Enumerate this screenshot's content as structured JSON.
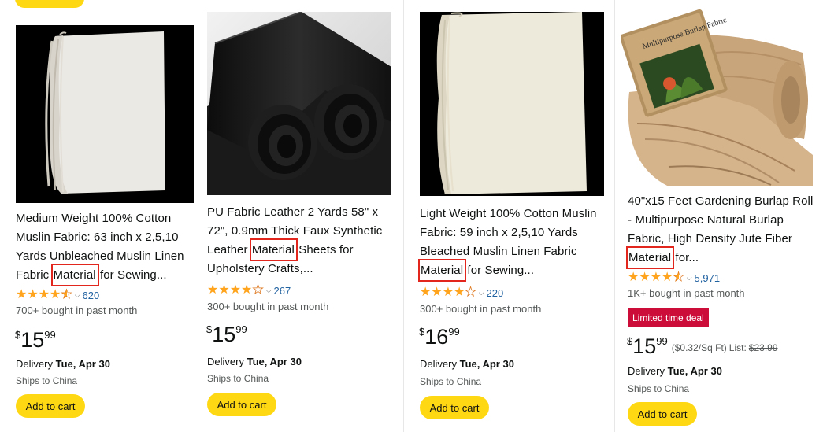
{
  "products": [
    {
      "title_pre": "Medium Weight 100% Cotton Muslin Fabric: 63 inch x 2,5,10 Yards Unbleached Muslin Linen Fabric ",
      "highlight": "Material",
      "title_post": " for Sewing...",
      "rating_count": "620",
      "bought": "700+ bought in past month",
      "price_symbol": "$",
      "price_whole": "15",
      "price_fraction": "99",
      "delivery_label": "Delivery",
      "delivery_date": "Tue, Apr 30",
      "ships": "Ships to China",
      "cart_label": "Add to cart"
    },
    {
      "title_pre": "PU Fabric Leather 2 Yards 58\" x 72\", 0.9mm Thick Faux Synthetic Leather ",
      "highlight": "Material",
      "title_post": " Sheets for Upholstery Crafts,...",
      "rating_count": "267",
      "bought": "300+ bought in past month",
      "price_symbol": "$",
      "price_whole": "15",
      "price_fraction": "99",
      "delivery_label": "Delivery",
      "delivery_date": "Tue, Apr 30",
      "ships": "Ships to China",
      "cart_label": "Add to cart"
    },
    {
      "title_pre": "Light Weight 100% Cotton Muslin Fabric: 59 inch x 2,5,10 Yards Bleached Muslin Linen Fabric ",
      "highlight": "Material",
      "title_post": " for Sewing...",
      "rating_count": "220",
      "bought": "300+ bought in past month",
      "price_symbol": "$",
      "price_whole": "16",
      "price_fraction": "99",
      "delivery_label": "Delivery",
      "delivery_date": "Tue, Apr 30",
      "ships": "Ships to China",
      "cart_label": "Add to cart"
    },
    {
      "title_pre": "40\"x15 Feet Gardening Burlap Roll - Multipurpose Natural Burlap Fabric, High Density Jute Fiber ",
      "highlight": "Material",
      "title_post": " for...",
      "rating_count": "5,971",
      "bought": "1K+ bought in past month",
      "deal_badge": "Limited time deal",
      "price_symbol": "$",
      "price_whole": "15",
      "price_fraction": "99",
      "unit_price": "($0.32/Sq Ft)",
      "list_label": "List:",
      "list_price": "$23.99",
      "delivery_label": "Delivery",
      "delivery_date": "Tue, Apr 30",
      "ships": "Ships to China",
      "cart_label": "Add to cart",
      "package_text": "Multipurpose Burlap Fabric"
    }
  ],
  "ratings": [
    "4.5 stars",
    "4 stars",
    "4 stars",
    "4.5 stars"
  ],
  "colors": {
    "star": "#ffa41c",
    "link": "#2162a1",
    "button": "#ffd814",
    "highlight_box": "#e3261d",
    "deal": "#cc0c39"
  }
}
